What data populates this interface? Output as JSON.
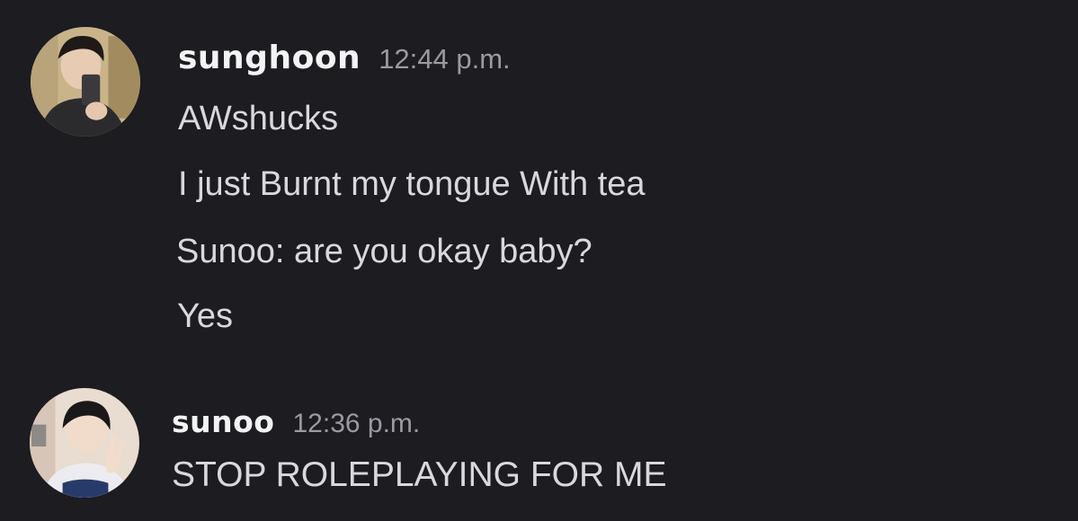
{
  "messages": [
    {
      "username": "sunghoon",
      "timestamp": "12:44 p.m.",
      "lines": [
        "AWshucks",
        "I just Burnt my tongue With tea",
        "Sunoo: are you okay baby?",
        "Yes"
      ]
    },
    {
      "username": "sunoo",
      "timestamp": "12:36 p.m.",
      "lines": [
        "STOP ROLEPLAYING FOR ME"
      ]
    }
  ],
  "colors": {
    "background": "#1c1c21",
    "username": "#f2f3f5",
    "timestamp": "#9a9ba2",
    "message_text": "#d8d9dc"
  }
}
